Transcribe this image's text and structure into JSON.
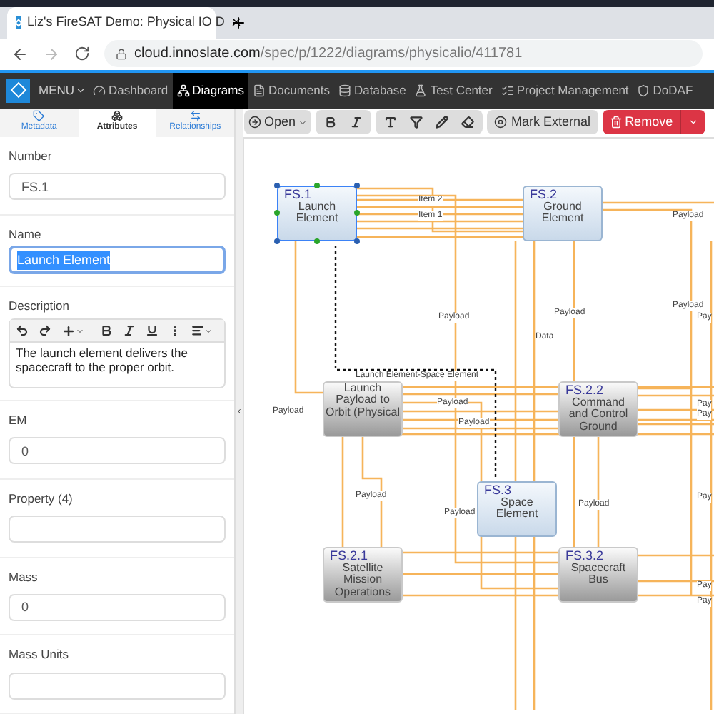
{
  "browser": {
    "tab_title": "Liz's FireSAT Demo: Physical IO D",
    "url_host": "cloud.innoslate.com",
    "url_path": "/spec/p/1222/diagrams/physicalio/411781"
  },
  "nav": {
    "menu": "MENU",
    "items": [
      {
        "label": "Dashboard",
        "selected": false
      },
      {
        "label": "Diagrams",
        "selected": true
      },
      {
        "label": "Documents",
        "selected": false
      },
      {
        "label": "Database",
        "selected": false
      },
      {
        "label": "Test Center",
        "selected": false
      },
      {
        "label": "Project Management",
        "selected": false
      },
      {
        "label": "DoDAF",
        "selected": false
      }
    ]
  },
  "panel_tabs": [
    {
      "label": "Metadata",
      "selected": false
    },
    {
      "label": "Attributes",
      "selected": true
    },
    {
      "label": "Relationships",
      "selected": false
    }
  ],
  "fields": [
    {
      "kind": "text",
      "label": "Number",
      "value": "FS.1"
    },
    {
      "kind": "highlighted",
      "label": "Name",
      "value": "Launch Element"
    },
    {
      "kind": "editor",
      "label": "Description",
      "value": "The launch element delivers the spacecraft to the proper orbit."
    },
    {
      "kind": "text",
      "label": "EM",
      "value": "0"
    },
    {
      "kind": "text",
      "label": "Property (4)"
    },
    {
      "kind": "text",
      "label": "Mass",
      "value": "0"
    },
    {
      "kind": "text",
      "label": "Mass Units"
    }
  ],
  "toolbar": {
    "open": "Open",
    "mark_external": "Mark External",
    "remove": "Remove"
  },
  "nodes": [
    {
      "number": "FS.1",
      "name": "Launch Element",
      "kind": "blue",
      "selected": true
    },
    {
      "number": "FS.2",
      "name": "Ground Element",
      "kind": "blue",
      "selected": false
    },
    {
      "name": "Launch Payload to Orbit (Physical",
      "kind": "gray",
      "selected": false
    },
    {
      "number": "FS.2.2",
      "name": "Command and Control Ground",
      "kind": "gray",
      "selected": false
    },
    {
      "number": "FS.3",
      "name": "Space Element",
      "kind": "blue",
      "selected": false
    },
    {
      "number": "FS.2.1",
      "name": "Satellite Mission Operations",
      "kind": "gray",
      "selected": false
    },
    {
      "number": "FS.3.2",
      "name": "Spacecraft Bus",
      "kind": "gray",
      "selected": false
    }
  ],
  "edge_labels": [
    "Item 2",
    "Item 1",
    "Payload",
    "Payload",
    "Payload",
    "Data",
    "Payload",
    "Launch Element-Space Element",
    "Payload",
    "Payload",
    "Payload",
    "Payload",
    "Payload",
    "Payload",
    "Pay",
    "Pay",
    "Pay",
    "Pay",
    "Pay",
    "Pay"
  ]
}
